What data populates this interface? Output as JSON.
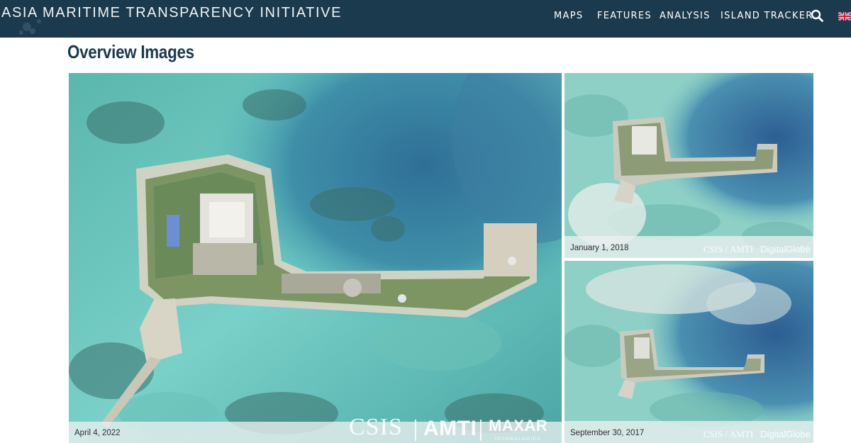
{
  "header": {
    "site_title": "ASIA MARITIME TRANSPARENCY INITIATIVE",
    "nav": [
      {
        "label": "MAPS"
      },
      {
        "label": "FEATURES"
      },
      {
        "label": "ANALYSIS"
      },
      {
        "label": "ISLAND TRACKER"
      }
    ],
    "icons": [
      "search-icon",
      "uk-flag-icon"
    ],
    "colors": {
      "bar": "#1c3a4d",
      "text": "#ffffff"
    }
  },
  "section": {
    "title": "Overview Images"
  },
  "images": {
    "main": {
      "date": "April 4, 2022",
      "credit": {
        "csis": "CSIS",
        "amti": "AMTI",
        "maxar": "MAXAR",
        "maxar_sub": "TECHNOLOGIES"
      }
    },
    "top_right": {
      "date": "January 1, 2018",
      "credit": {
        "csis": "CSIS",
        "amti": "AMTI",
        "provider": "DigitalGlobe"
      }
    },
    "bottom_right": {
      "date": "September 30, 2017",
      "credit": {
        "csis": "CSIS",
        "amti": "AMTI",
        "provider": "DigitalGlobe"
      }
    }
  }
}
